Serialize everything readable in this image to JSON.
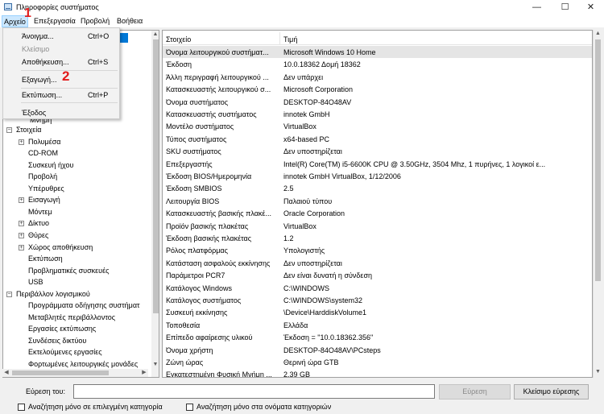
{
  "window": {
    "title": "Πληροφορίες συστήματος",
    "minimize": "—",
    "maximize": "☐",
    "close": "✕"
  },
  "menubar": [
    "Αρχείο",
    "Επεξεργασία",
    "Προβολή",
    "Βοήθεια"
  ],
  "file_menu": {
    "items": [
      {
        "label": "Άνοιγμα...",
        "shortcut": "Ctrl+O"
      },
      {
        "label": "Κλείσιμο",
        "shortcut": ""
      },
      {
        "label": "Αποθήκευση...",
        "shortcut": "Ctrl+S"
      },
      {
        "label": "Εξαγωγή...",
        "shortcut": ""
      },
      {
        "label": "Εκτύπωση...",
        "shortcut": "Ctrl+P"
      },
      {
        "label": "Έξοδος",
        "shortcut": ""
      }
    ]
  },
  "annotations": {
    "step1": "1",
    "step2": "2"
  },
  "tree": {
    "partial_label": "Μνήμη",
    "items": [
      {
        "label": "Στοιχεία",
        "toggle": "−"
      },
      {
        "label": "Πολυμέσα",
        "toggle": "+"
      },
      {
        "label": "CD-ROM"
      },
      {
        "label": "Συσκευή ήχου"
      },
      {
        "label": "Προβολή"
      },
      {
        "label": "Υπέρυθρες"
      },
      {
        "label": "Εισαγωγή",
        "toggle": "+"
      },
      {
        "label": "Μόντεμ"
      },
      {
        "label": "Δίκτυο",
        "toggle": "+"
      },
      {
        "label": "Θύρες",
        "toggle": "+"
      },
      {
        "label": "Χώρος αποθήκευση",
        "toggle": "+"
      },
      {
        "label": "Εκτύπωση"
      },
      {
        "label": "Προβληματικές συσκευές"
      },
      {
        "label": "USB"
      },
      {
        "label": "Περιβάλλον λογισμικού",
        "toggle": "−"
      },
      {
        "label": "Προγράμματα οδήγησης συστήματ"
      },
      {
        "label": "Μεταβλητές περιβάλλοντος"
      },
      {
        "label": "Εργασίες εκτύπωσης"
      },
      {
        "label": "Συνδέσεις δικτύου"
      },
      {
        "label": "Εκτελούμενες εργασίες"
      },
      {
        "label": "Φορτωμένες λειτουργικές μονάδες"
      }
    ]
  },
  "grid": {
    "headers": [
      "Στοιχείο",
      "Τιμή"
    ],
    "rows": [
      [
        "Όνομα λειτουργικού συστήματ...",
        "Microsoft Windows 10 Home"
      ],
      [
        "Έκδοση",
        "10.0.18362 Δομή 18362"
      ],
      [
        "Άλλη περιγραφή λειτουργικού ...",
        "Δεν υπάρχει"
      ],
      [
        "Κατασκευαστής λειτουργικού σ...",
        "Microsoft Corporation"
      ],
      [
        "Όνομα συστήματος",
        "DESKTOP-84O48AV"
      ],
      [
        "Κατασκευαστής συστήματος",
        "innotek GmbH"
      ],
      [
        "Μοντέλο συστήματος",
        "VirtualBox"
      ],
      [
        "Τύπος συστήματος",
        "x64-based PC"
      ],
      [
        "SKU συστήματος",
        "Δεν υποστηρίζεται"
      ],
      [
        "Επεξεργαστής",
        "Intel(R) Core(TM) i5-6600K CPU @ 3.50GHz, 3504 Mhz, 1 πυρήνες, 1 λογικοί ε..."
      ],
      [
        "Έκδοση BIOS/Ημερομηνία",
        "innotek GmbH VirtualBox, 1/12/2006"
      ],
      [
        "Έκδοση SMBIOS",
        "2.5"
      ],
      [
        "Λειτουργία BIOS",
        "Παλαιού τύπου"
      ],
      [
        "Κατασκευαστής βασικής πλακέ...",
        "Oracle Corporation"
      ],
      [
        "Προϊόν βασικής πλακέτας",
        "VirtualBox"
      ],
      [
        "Έκδοση βασικής πλακέτας",
        "1.2"
      ],
      [
        "Ρόλος πλατφόρμας",
        "Υπολογιστής"
      ],
      [
        "Κατάσταση ασφαλούς εκκίνησης",
        "Δεν υποστηρίζεται"
      ],
      [
        "Παράμετροι PCR7",
        "Δεν είναι δυνατή η σύνδεση"
      ],
      [
        "Κατάλογος Windows",
        "C:\\WINDOWS"
      ],
      [
        "Κατάλογος συστήματος",
        "C:\\WINDOWS\\system32"
      ],
      [
        "Συσκευή εκκίνησης",
        "\\Device\\HarddiskVolume1"
      ],
      [
        "Τοποθεσία",
        "Ελλάδα"
      ],
      [
        "Επίπεδο αφαίρεσης υλικού",
        "Έκδοση = \"10.0.18362.356\""
      ],
      [
        "Όνομα χρήστη",
        "DESKTOP-84O48AV\\PCsteps"
      ],
      [
        "Ζώνη ώρας",
        "Θερινή ώρα GTB"
      ],
      [
        "Εγκατεστημένη Φυσική Μνήμη ...",
        "2,39 GB"
      ]
    ]
  },
  "find": {
    "label": "Εύρεση του:",
    "value": "",
    "find_button": "Εύρεση",
    "close_button": "Κλείσιμο εύρεσης",
    "check1": "Αναζήτηση μόνο σε επιλεγμένη κατηγορία",
    "check2": "Αναζήτηση μόνο στα ονόματα κατηγοριών"
  },
  "colors": {
    "selection": "#0078d7",
    "menu_hover": "#cce8ff",
    "annotation": "#e21b1b"
  }
}
